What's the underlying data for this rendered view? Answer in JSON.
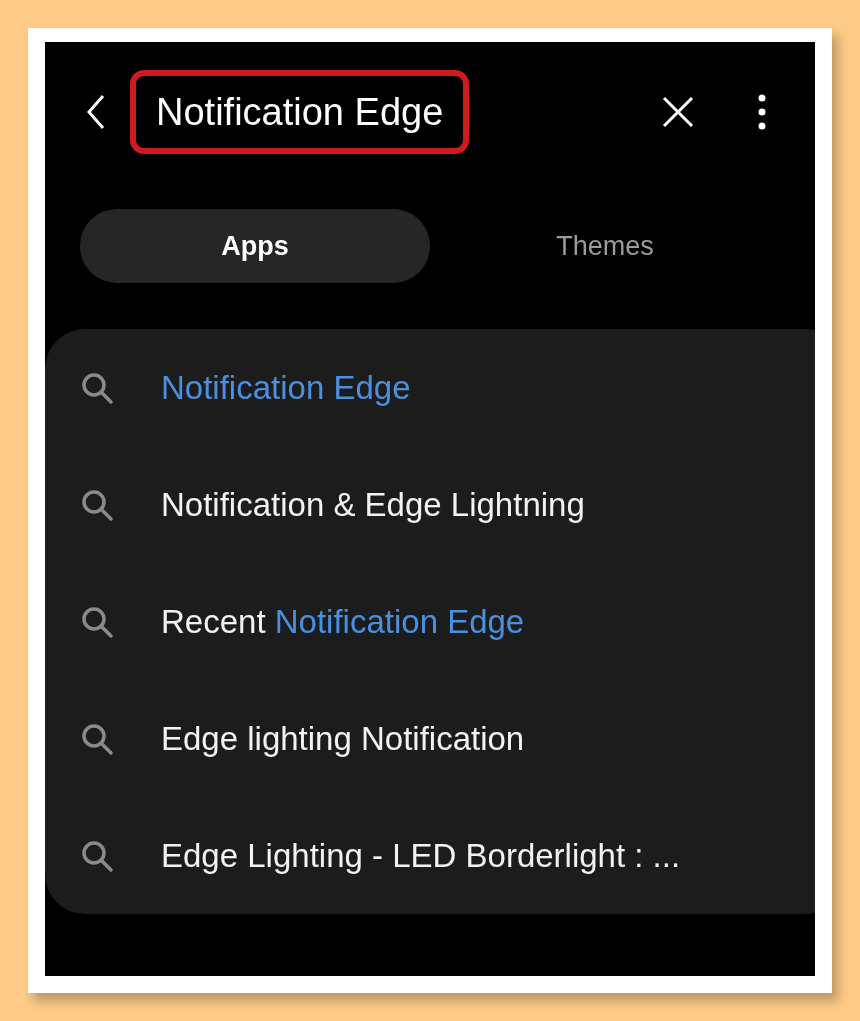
{
  "header": {
    "title": {
      "text": "Notification Edge",
      "outlined": true
    }
  },
  "tabs": [
    {
      "label": "Apps",
      "selected": true
    },
    {
      "label": "Themes",
      "selected": false
    }
  ],
  "suggestions": [
    {
      "parts": [
        {
          "text": "Notification Edge",
          "highlight": true
        }
      ]
    },
    {
      "parts": [
        {
          "text": "Notification & Edge Lightning",
          "highlight": false
        }
      ]
    },
    {
      "parts": [
        {
          "text": "Recent ",
          "highlight": false
        },
        {
          "text": "Notification Edge",
          "highlight": true
        }
      ]
    },
    {
      "parts": [
        {
          "text": "Edge lighting Notification",
          "highlight": false
        }
      ]
    },
    {
      "parts": [
        {
          "text": "Edge Lighting - LED Borderlight : ...",
          "highlight": false
        }
      ]
    }
  ]
}
